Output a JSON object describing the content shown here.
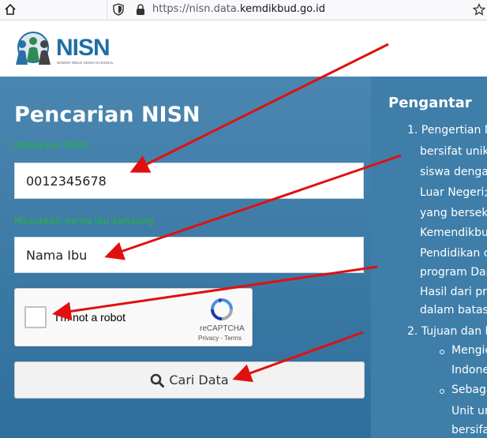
{
  "browser": {
    "url_prefix": "https://nisn.data.",
    "url_domain": "kemdikbud.go.id"
  },
  "logo": {
    "name": "NISN",
    "tagline": "NOMOR INDUK SISWA NASIONAL"
  },
  "search_form": {
    "title": "Pencarian NISN",
    "nisn_label": "Masukkan NISN",
    "nisn_value": "0012345678",
    "ibu_label": "Masukkan nama ibu kandung",
    "ibu_value": "Nama Ibu",
    "captcha": {
      "label": "I'm not a robot",
      "brand": "reCAPTCHA",
      "links": "Privacy - Terms"
    },
    "submit_label": "Cari Data"
  },
  "intro": {
    "title": "Pengantar",
    "lines": [
      "1. Pengertian N",
      "bersifat unik",
      "siswa dengan",
      "Luar Negeri;",
      "yang bersekc",
      "Kemendikbu",
      "Pendidikan c",
      "program Dap",
      "Hasil dari pro",
      "dalam batas",
      "2. Tujuan dan M",
      "Mengic",
      "Indone",
      "Sebaga",
      "Unit ur",
      "bersifa"
    ]
  },
  "colors": {
    "brand_blue": "#1f6fa5",
    "panel_blue": "#3a7aa6",
    "label_green": "#23b53f",
    "arrow_red": "#e01010"
  }
}
